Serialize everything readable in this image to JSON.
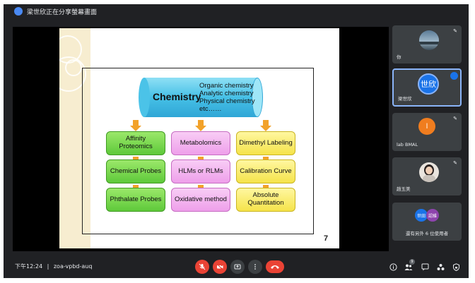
{
  "topbar": {
    "share_text": "梁世欣正在分享螢幕畫面"
  },
  "slide": {
    "center": {
      "title": "Chemistry",
      "lines": [
        "Organic chemistry",
        "Analytic chemistry",
        "Physical chemistry",
        "etc……"
      ]
    },
    "columns": [
      {
        "color": "green",
        "items": [
          "Affinity Proteomics",
          "Chemical Probes",
          "Phthalate Probes"
        ]
      },
      {
        "color": "pink",
        "items": [
          "Metabolomics",
          "HLMs or RLMs",
          "Oxidative method"
        ]
      },
      {
        "color": "yellow",
        "items": [
          "Dimethyl Labeling",
          "Calibration Curve",
          "Absolute Quantitation"
        ]
      }
    ],
    "page_number": "7",
    "colors": {
      "arrow": "#f2a22a",
      "cylinder": "#46c0e6",
      "green": "#6dd345",
      "pink": "#f2b4ee",
      "yellow": "#f8e85c"
    }
  },
  "participants": [
    {
      "name": "你",
      "type": "photo-landscape"
    },
    {
      "name": "梁世欣",
      "avatar_text": "世欣",
      "avatar_color": "#1a73e8",
      "active": true
    },
    {
      "name": "lab BMAL",
      "avatar_text": "l",
      "avatar_color": "#f07d1f"
    },
    {
      "name": "趙玉美",
      "type": "photo-person"
    },
    {
      "others_text": "還有另外 6 位使用者",
      "avatars": [
        "世田",
        "認維"
      ]
    }
  ],
  "bottombar": {
    "time": "下午12:24",
    "separator": "|",
    "meeting_code": "zoa-vpbd-auq",
    "people_count": "9"
  },
  "icons": {
    "controls": [
      "mic-off-icon",
      "camera-off-icon",
      "present-icon",
      "more-icon",
      "hang-up-icon"
    ],
    "right": [
      "info-icon",
      "people-icon",
      "chat-icon",
      "activities-icon",
      "lock-icon"
    ]
  }
}
